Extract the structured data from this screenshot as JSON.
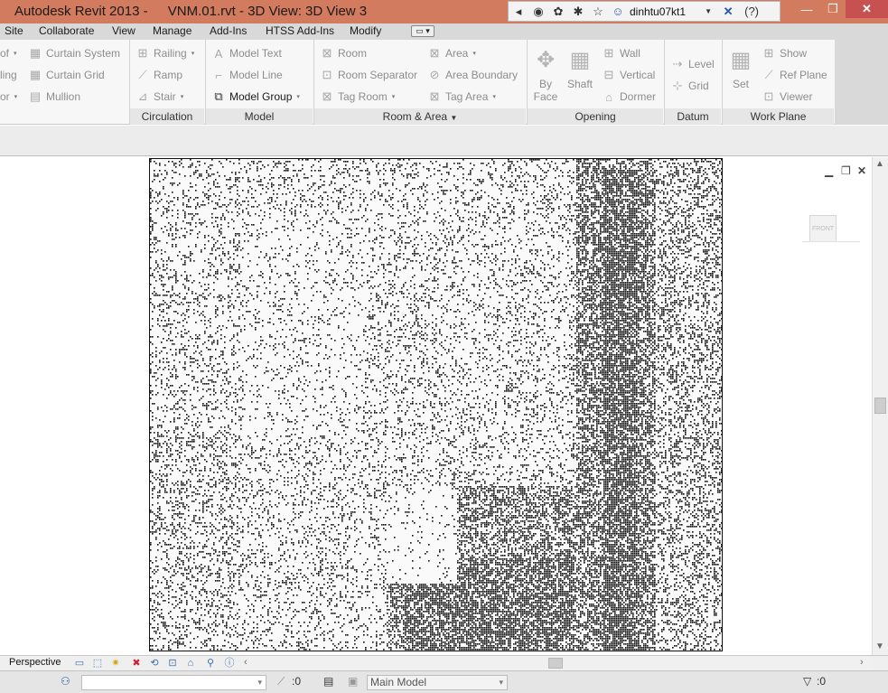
{
  "titlebar": {
    "app_title": "Autodesk Revit 2013 -",
    "doc_title": "VNM.01.rvt - 3D View: 3D View 3",
    "user": "dinhtu07kt1",
    "icons": [
      "nav-left-icon",
      "binoculars-icon",
      "wrench-icon",
      "communication-icon",
      "star-icon",
      "user-icon",
      "x-exchange-icon",
      "help-icon"
    ]
  },
  "menu": {
    "tabs": [
      "Site",
      "Collaborate",
      "View",
      "Manage",
      "Add-Ins",
      "HTSS Add-Ins",
      "Modify"
    ]
  },
  "ribbon": {
    "build": {
      "items": [
        "of",
        "ling",
        "or"
      ]
    },
    "curtain": {
      "items": [
        "Curtain System",
        "Curtain Grid",
        "Mullion"
      ]
    },
    "circulation": {
      "label": "Circulation",
      "items": [
        "Railing",
        "Ramp",
        "Stair"
      ]
    },
    "model": {
      "label": "Model",
      "items": [
        "Model Text",
        "Model Line",
        "Model Group"
      ]
    },
    "room_area": {
      "label": "Room & Area",
      "col1": [
        "Room",
        "Room Separator",
        "Tag Room"
      ],
      "col2": [
        "Area",
        "Area Boundary",
        "Tag Area"
      ]
    },
    "opening": {
      "label": "Opening",
      "by_face": [
        "By",
        "Face"
      ],
      "shaft": "Shaft",
      "items": [
        "Wall",
        "Vertical",
        "Dormer"
      ]
    },
    "datum": {
      "label": "Datum",
      "items": [
        "Level",
        "Grid"
      ]
    },
    "work_plane": {
      "label": "Work Plane",
      "set": "Set",
      "items": [
        "Show",
        "Ref Plane",
        "Viewer"
      ]
    }
  },
  "view": {
    "viewcube_face": "FRONT"
  },
  "view_control": {
    "mode": "Perspective"
  },
  "status": {
    "count_a": ":0",
    "model": "Main Model",
    "filter_count": ":0"
  }
}
